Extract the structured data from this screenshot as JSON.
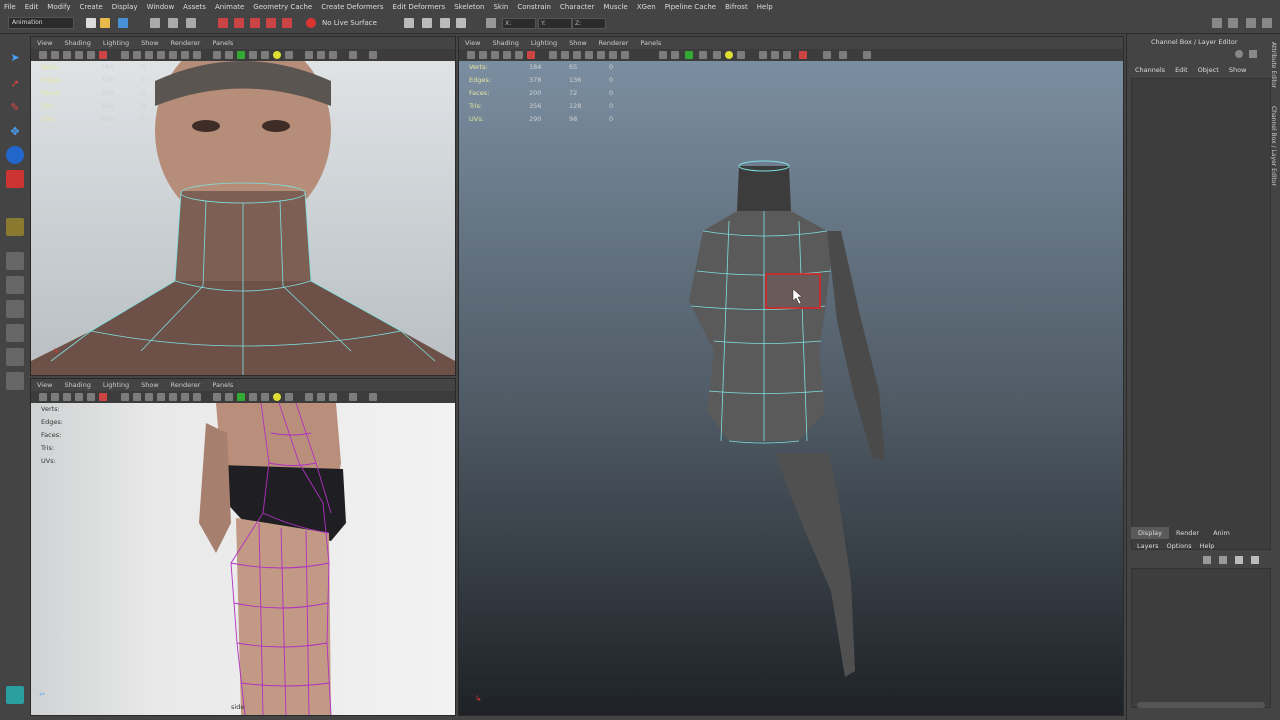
{
  "menubar": {
    "items": [
      "File",
      "Edit",
      "Modify",
      "Create",
      "Display",
      "Window",
      "Assets",
      "Animate",
      "Geometry Cache",
      "Create Deformers",
      "Edit Deformers",
      "Skeleton",
      "Skin",
      "Constrain",
      "Character",
      "Muscle",
      "XGen",
      "Pipeline Cache",
      "Bifrost",
      "Help"
    ]
  },
  "statusline": {
    "mode": "Animation",
    "live_surface": "No Live Surface",
    "coord_x": "X:",
    "coord_y": "Y:",
    "coord_z": "Z:"
  },
  "panels": {
    "menu": [
      "View",
      "Shading",
      "Lighting",
      "Show",
      "Renderer",
      "Panels"
    ],
    "side_label": "side"
  },
  "hud": {
    "labels": [
      "Verts:",
      "Edges:",
      "Faces:",
      "Tris:",
      "UVs:"
    ],
    "persp_values": [
      [
        "184",
        "65",
        "0"
      ],
      [
        "378",
        "136",
        "0"
      ],
      [
        "200",
        "72",
        "0"
      ],
      [
        "356",
        "128",
        "0"
      ],
      [
        "290",
        "98",
        "0"
      ]
    ],
    "front_values": [
      [
        "184",
        "65",
        "0"
      ],
      [
        "378",
        "136",
        "0"
      ],
      [
        "200",
        "72",
        "0"
      ],
      [
        "356",
        "128",
        "0"
      ],
      [
        "290",
        "98",
        "0"
      ]
    ]
  },
  "channel_box": {
    "title": "Channel Box / Layer Editor",
    "menu": [
      "Channels",
      "Edit",
      "Object",
      "Show"
    ],
    "tabs": [
      "Display",
      "Render",
      "Anim"
    ],
    "layer_menu": [
      "Layers",
      "Options",
      "Help"
    ],
    "side_tab_1": "Attribute Editor",
    "side_tab_2": "Channel Box / Layer Editor"
  },
  "colors": {
    "accent_selection": "#e02020",
    "wire": "#7fe0e0",
    "hud_label": "#e6e6a0"
  }
}
